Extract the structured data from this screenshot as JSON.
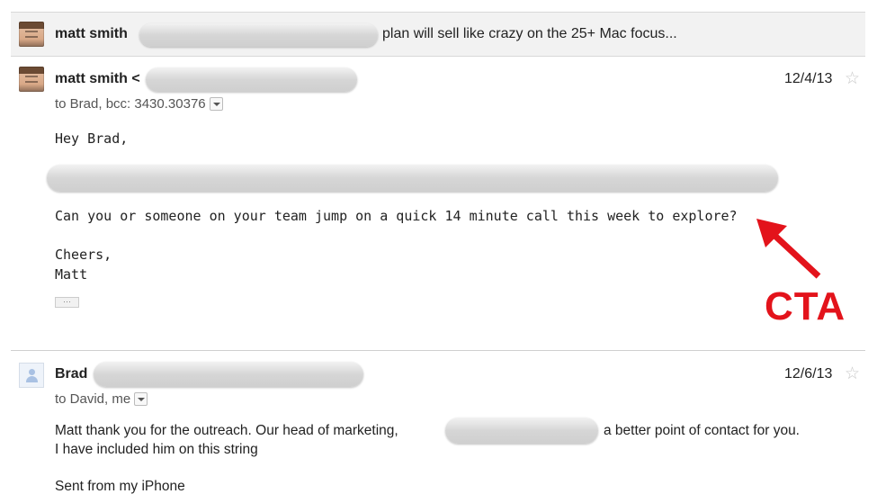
{
  "collapsed_message": {
    "sender": "matt smith",
    "snippet": "plan will sell like crazy on the 25+ Mac focus..."
  },
  "message1": {
    "sender": "matt smith <",
    "recipients": "to Brad, bcc: 3430.30376",
    "date": "12/4/13",
    "star": "☆",
    "greeting": "Hey Brad,",
    "question": "Can you or someone on your team jump on a quick 14 minute call this week to explore?",
    "signoff": "Cheers,",
    "signature": "Matt",
    "ellipsis": "···"
  },
  "annotation": {
    "label": "CTA",
    "color": "#e3131b"
  },
  "message2": {
    "sender": "Brad",
    "recipients": "to David, me",
    "date": "12/6/13",
    "star": "☆",
    "body_part1": "Matt thank you for the outreach. Our head of marketing,",
    "body_part2": "a better point of contact for you.",
    "body_line2": "I have included him on this string",
    "footer": "Sent from my iPhone"
  },
  "icons": {
    "sender_avatar": "user-photo-avatar",
    "generic_avatar": "default-person-avatar",
    "dropdown": "chevron-down-icon",
    "star": "star-outline-icon"
  }
}
